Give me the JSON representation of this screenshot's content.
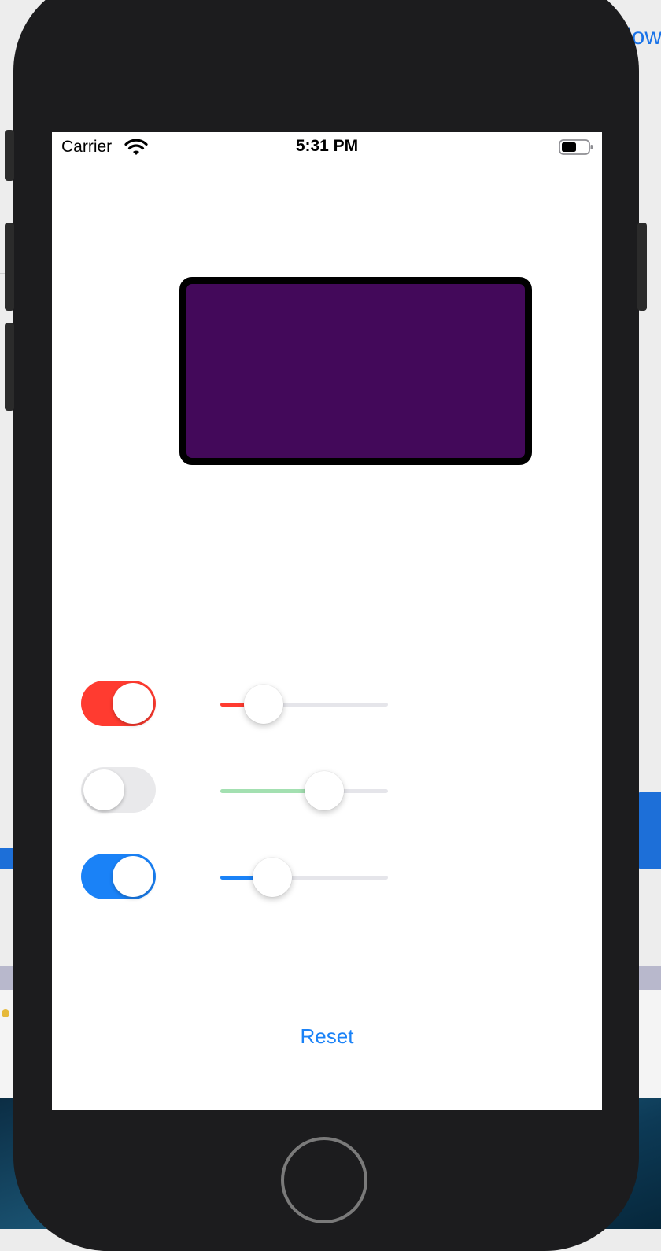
{
  "background": {
    "link_fragment": "low"
  },
  "status_bar": {
    "carrier": "Carrier",
    "time": "5:31 PM",
    "wifi_icon": "wifi-icon",
    "battery_icon": "battery-icon"
  },
  "color_box": {
    "fill_color": "#43095a",
    "border_color": "#000000"
  },
  "controls": [
    {
      "channel": "red",
      "toggle_on": true,
      "toggle_color": "#ff3b30",
      "slider_value": 0.26,
      "slider_color": "#ff3b30"
    },
    {
      "channel": "green",
      "toggle_on": false,
      "toggle_color": "#34c759",
      "slider_value": 0.62,
      "slider_color": "#a3e0b1"
    },
    {
      "channel": "blue",
      "toggle_on": true,
      "toggle_color": "#1a82f7",
      "slider_value": 0.31,
      "slider_color": "#1a82f7"
    }
  ],
  "reset_button": {
    "label": "Reset"
  }
}
